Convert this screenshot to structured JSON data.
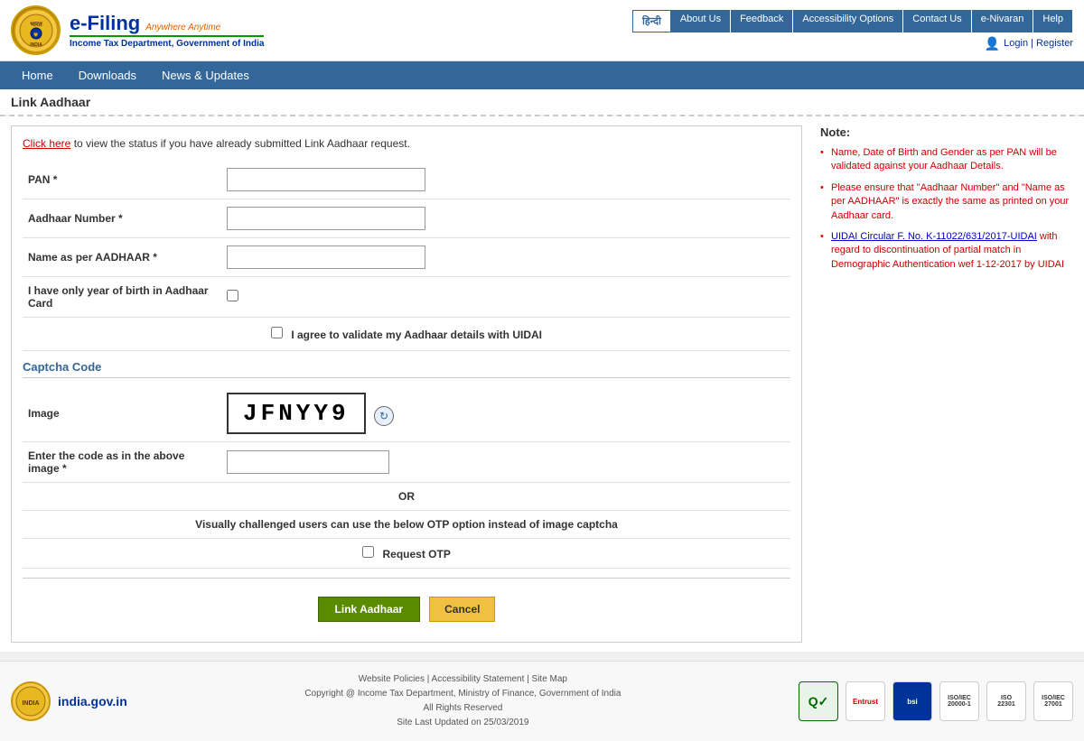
{
  "header": {
    "emblem_label": "Govt\nEmblem",
    "efiling": "e-Filing",
    "anywhere_anytime": "Anywhere Anytime",
    "department": "Income Tax Department, Government of India",
    "hindi_label": "हिन्दी",
    "nav_links": [
      "About Us",
      "Feedback",
      "Accessibility Options",
      "Contact Us",
      "e-Nivaran",
      "Help"
    ],
    "login_register": "Login | Register"
  },
  "main_nav": {
    "items": [
      "Home",
      "Downloads",
      "News & Updates"
    ]
  },
  "page": {
    "title": "Link Aadhaar",
    "status_link_text": "Click here",
    "status_text": " to view the status if you have already submitted Link Aadhaar request.",
    "form": {
      "pan_label": "PAN *",
      "aadhaar_label": "Aadhaar Number *",
      "name_label": "Name as per AADHAAR *",
      "year_of_birth_label": "I have only year of birth in Aadhaar Card",
      "agree_label": "I agree to validate my Aadhaar details with UIDAI",
      "captcha_section_title": "Captcha Code",
      "image_label": "Image",
      "captcha_code": "JFNYY9",
      "enter_code_label": "Enter the code as in the above image *",
      "or_label": "OR",
      "otp_desc": "Visually challenged users can use the below OTP option instead of image captcha",
      "otp_label": "Request OTP",
      "btn_link": "Link Aadhaar",
      "btn_cancel": "Cancel"
    },
    "notes": {
      "title": "Note:",
      "items": [
        "Name, Date of Birth and Gender as per PAN will be validated against your Aadhaar Details.",
        "Please ensure that \"Aadhaar Number\" and \"Name as per AADHAAR\" is exactly the same as printed on your Aadhaar card.",
        "UIDAI Circular F. No. K-11022/631/2017-UIDAI with regard to discontinuation of partial match in Demographic Authentication wef 1-12-2017 by UIDAI"
      ]
    }
  },
  "footer": {
    "gov_label": "india.gov.in",
    "policy_links": "Website Policies | Accessibility Statement | Site Map",
    "copyright": "Copyright @ Income Tax Department, Ministry of Finance, Government of India",
    "rights": "All Rights Reserved",
    "last_updated": "Site Last Updated on 25/03/2019"
  }
}
